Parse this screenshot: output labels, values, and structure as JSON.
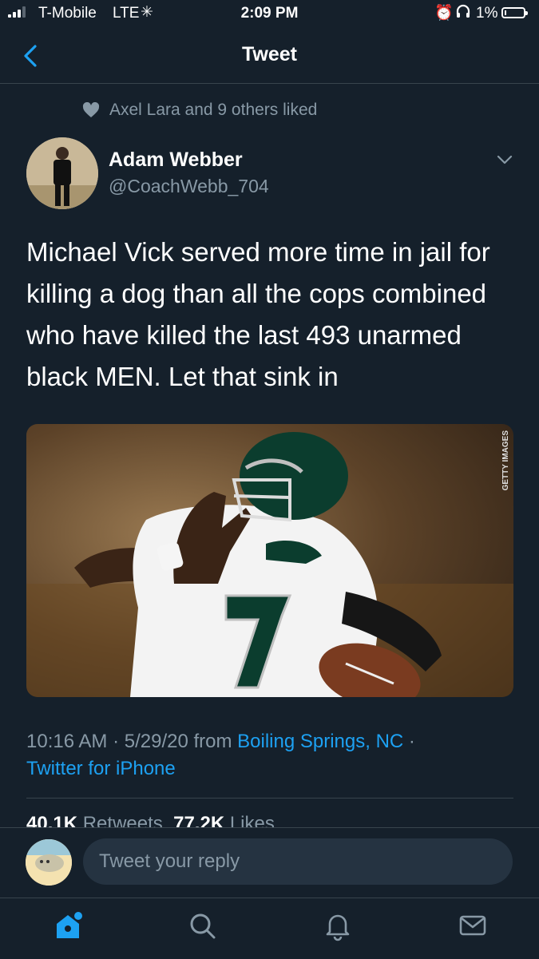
{
  "status_bar": {
    "carrier": "T-Mobile",
    "network": "LTE",
    "time": "2:09 PM",
    "battery_percent": "1%",
    "icons": [
      "signal-icon",
      "activity-spinner-icon",
      "alarm-icon",
      "headphones-icon",
      "battery-icon"
    ]
  },
  "header": {
    "title": "Tweet",
    "back_icon": "chevron-left-icon"
  },
  "tweet": {
    "liked_by": "Axel Lara and 9 others liked",
    "author_name": "Adam Webber",
    "author_handle": "@CoachWebb_704",
    "text": "Michael Vick served more time in jail for killing a dog than all the cops combined who have killed the last 493 unarmed black MEN. Let that sink in",
    "image_credit": "GETTY IMAGES",
    "timestamp": "10:16 AM · 5/29/20 from ",
    "location": "Boiling Springs, NC",
    "separator": " ·",
    "client": "Twitter for iPhone",
    "retweets_count": "40.1K",
    "retweets_label": "Retweets",
    "likes_count": "77.2K",
    "likes_label": "Likes"
  },
  "reply": {
    "placeholder": "Tweet your reply"
  },
  "tabs": [
    {
      "name": "home",
      "icon": "home-icon",
      "active": true
    },
    {
      "name": "search",
      "icon": "search-icon"
    },
    {
      "name": "notifications",
      "icon": "bell-icon"
    },
    {
      "name": "messages",
      "icon": "mail-icon"
    }
  ],
  "colors": {
    "background": "#15202b",
    "accent": "#1da1f2",
    "secondary_text": "#8899a6",
    "divider": "#38444d"
  }
}
